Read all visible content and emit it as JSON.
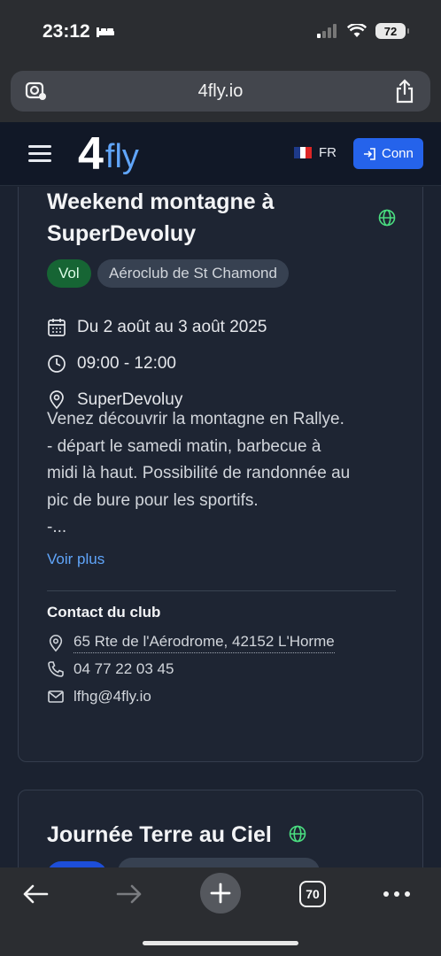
{
  "status": {
    "time": "23:12",
    "battery": "72"
  },
  "browser": {
    "url": "4fly.io",
    "tabs_count": "70"
  },
  "navbar": {
    "logo_number": "4",
    "logo_text": "fly",
    "lang": "FR",
    "connect_label": "Conn"
  },
  "event1": {
    "title_line1": "Weekend montagne à",
    "title_line2": "SuperDevoluy",
    "badge": "Vol",
    "club": "Aéroclub de St Chamond",
    "date": "Du 2 août au 3 août 2025",
    "time": "09:00 - 12:00",
    "location": "SuperDevoluy",
    "description": [
      "Venez découvrir la montagne en Rallye.",
      "- départ le samedi matin, barbecue à",
      "midi là haut. Possibilité de randonnée au",
      "pic de bure pour les sportifs.",
      "-..."
    ],
    "see_more": "Voir plus",
    "contact_heading": "Contact du club",
    "address": "65 Rte de l'Aérodrome, 42152 L'Horme",
    "phone": "04 77 22 03 45",
    "email": "lfhg@4fly.io"
  },
  "event2": {
    "title": "Journée Terre au Ciel"
  },
  "colors": {
    "accent": "#2563eb",
    "link": "#60a5fa",
    "badge_green": "#166534",
    "background": "#1b2230"
  }
}
